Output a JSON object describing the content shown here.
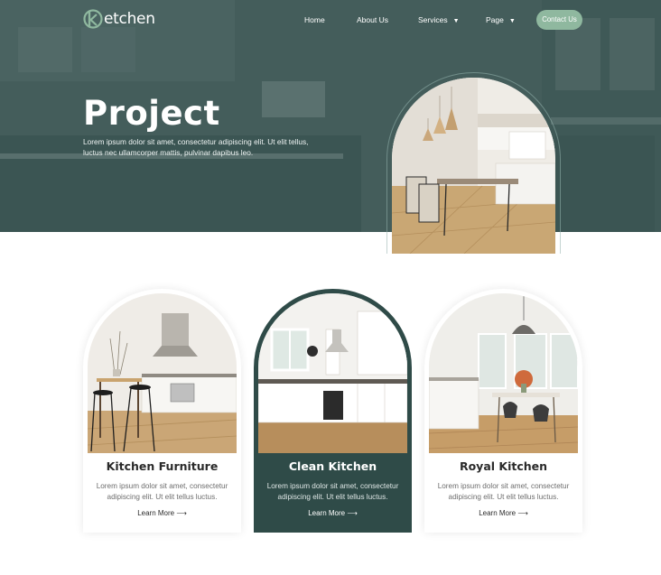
{
  "brand": {
    "logo_letter": "k",
    "name": "etchen"
  },
  "nav": {
    "items": [
      {
        "label": "Home"
      },
      {
        "label": "About Us"
      },
      {
        "label": "Services",
        "has_dropdown": true
      },
      {
        "label": "Page",
        "has_dropdown": true
      }
    ],
    "contact_label": "Contact Us"
  },
  "hero": {
    "title": "Project",
    "description": "Lorem ipsum dolor sit amet, consectetur adipiscing elit. Ut elit tellus, luctus nec ullamcorper mattis, pulvinar dapibus leo."
  },
  "cards": [
    {
      "title": "Kitchen Furniture",
      "text": "Lorem ipsum dolor sit amet, consectetur adipiscing elit. Ut elit tellus luctus.",
      "link": "Learn More",
      "active": false
    },
    {
      "title": "Clean Kitchen",
      "text": "Lorem ipsum dolor sit amet, consectetur adipiscing elit. Ut elit tellus luctus.",
      "link": "Learn More",
      "active": true
    },
    {
      "title": "Royal Kitchen",
      "text": "Lorem ipsum dolor sit amet, consectetur adipiscing elit. Ut elit tellus luctus.",
      "link": "Learn More",
      "active": false
    }
  ],
  "icons": {
    "dropdown": "chevron-down-icon",
    "link_arrow": "arrow-right-icon"
  },
  "colors": {
    "hero_overlay": "#3d5755",
    "accent": "#8fb89f",
    "active_card": "#2f4b48"
  }
}
